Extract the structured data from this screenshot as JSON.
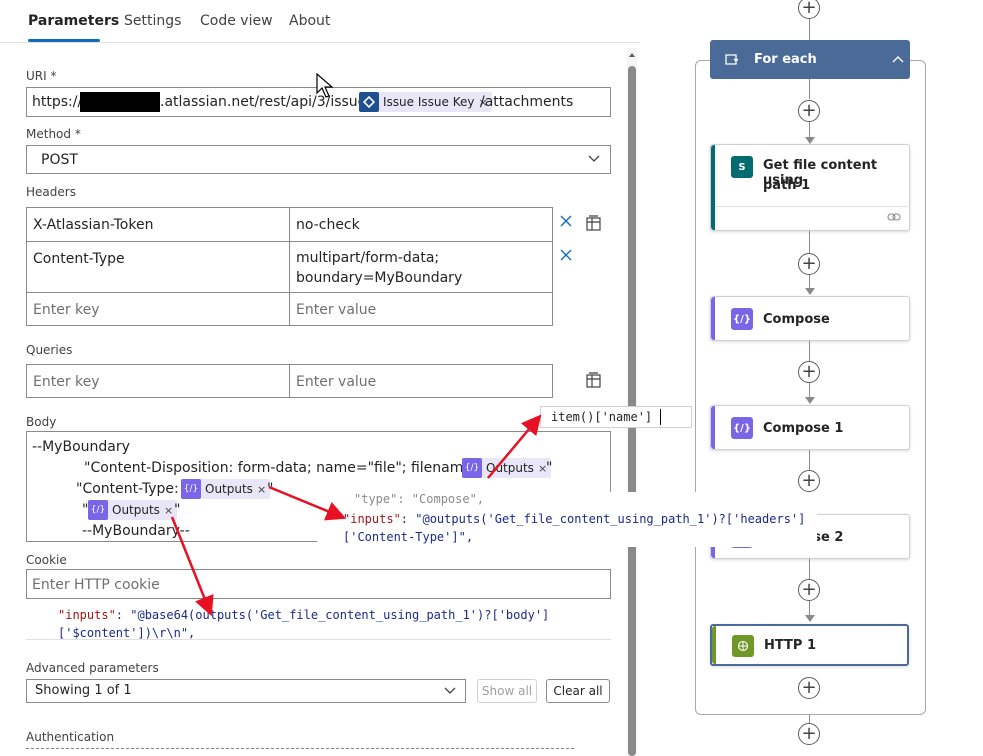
{
  "tabs": [
    {
      "label": "Parameters",
      "active": true
    },
    {
      "label": "Settings"
    },
    {
      "label": "Code view"
    },
    {
      "label": "About"
    }
  ],
  "uri": {
    "label": "URI *",
    "prefix": "https://",
    "middle": ".atlassian.net/rest/api/3/issue/",
    "token": "Issue Issue Key",
    "suffix": "/attachments"
  },
  "method": {
    "label": "Method *",
    "value": "POST"
  },
  "headers": {
    "label": "Headers",
    "rows": [
      {
        "key": "X-Atlassian-Token",
        "value": "no-check"
      },
      {
        "key": "Content-Type",
        "value_line1": "multipart/form-data;",
        "value_line2": "boundary=MyBoundary"
      }
    ],
    "key_placeholder": "Enter key",
    "value_placeholder": "Enter value"
  },
  "queries": {
    "label": "Queries",
    "key_placeholder": "Enter key",
    "value_placeholder": "Enter value"
  },
  "body": {
    "label": "Body",
    "line1": "--MyBoundary",
    "line2": "\"Content-Disposition: form-data; name=\"file\"; filename=\"",
    "line2_end": "\"",
    "line3": "\"Content-Type:",
    "line3_end": "\"",
    "line4_start": "\"",
    "line4_end": "\"",
    "line5": "--MyBoundary--",
    "token_label": "Outputs"
  },
  "cookie": {
    "label": "Cookie",
    "placeholder": "Enter HTTP cookie"
  },
  "advanced": {
    "label": "Advanced parameters",
    "select_value": "Showing 1 of 1",
    "show_all": "Show all",
    "clear_all": "Clear all"
  },
  "authentication": {
    "label": "Authentication"
  },
  "annotations": {
    "item_expr": "item()['name']",
    "inputs_ct_line0": "\"type\": \"Compose\",",
    "inputs_ct_key": "\"inputs\"",
    "inputs_ct_val": ": \"@outputs('Get_file_content_using_path_1')?['headers']",
    "inputs_ct_line2": "['Content-Type']\",",
    "inputs_body_key": "\"inputs\"",
    "inputs_body_val": ": \"@base64(outputs('Get_file_content_using_path_1')?['body']",
    "inputs_body_line2": "['$content'])\\r\\n\","
  },
  "flow": {
    "foreach_label": "For each",
    "actions": [
      {
        "label_line1": "Get file content using",
        "label_line2": "path 1",
        "icon": "sharepoint-icon",
        "accent": "#036c70"
      },
      {
        "label": "Compose",
        "icon": "compose-icon",
        "accent": "#7a65e6"
      },
      {
        "label": "Compose 1",
        "icon": "compose-icon",
        "accent": "#7a65e6"
      },
      {
        "label": "Compose 2",
        "icon": "compose-icon",
        "accent": "#7a65e6"
      },
      {
        "label": "HTTP 1",
        "icon": "globe-icon",
        "accent": "#709727"
      }
    ]
  },
  "colors": {
    "accent": "#0f6cbd",
    "foreach": "#4a6a97",
    "arrow": "#e81123"
  }
}
